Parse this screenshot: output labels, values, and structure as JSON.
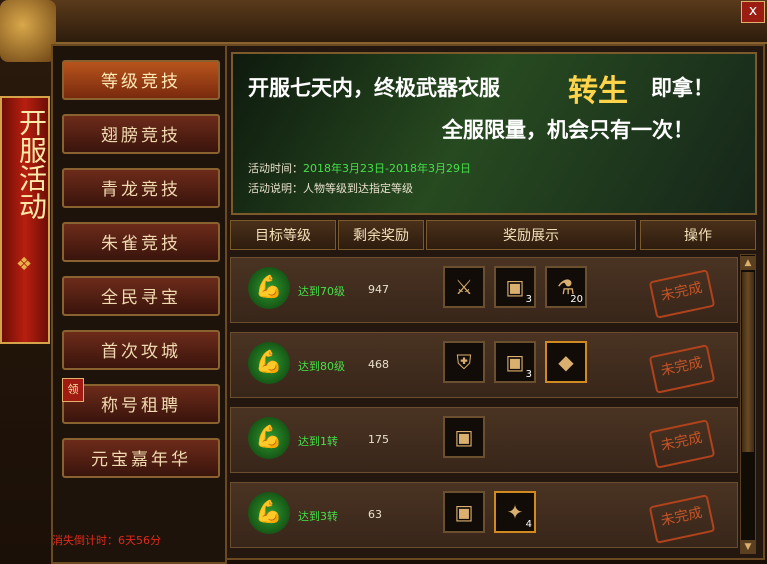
{
  "window": {
    "close_symbol": "x"
  },
  "ribbon": {
    "title": "开服活动"
  },
  "nav": {
    "items": [
      {
        "label": "等级竞技"
      },
      {
        "label": "翅膀竞技"
      },
      {
        "label": "青龙竞技"
      },
      {
        "label": "朱雀竞技"
      },
      {
        "label": "全民寻宝"
      },
      {
        "label": "首次攻城"
      },
      {
        "label": "称号租聘"
      },
      {
        "label": "元宝嘉年华"
      }
    ],
    "badge": "领"
  },
  "countdown": "消失倒计时：6天56分",
  "banner": {
    "line1_a": "开服七天内，终极武器衣服",
    "line1_b": "转生",
    "line1_c": "即拿！",
    "line2": "全服限量，机会只有一次！",
    "time_label": "活动时间：",
    "time_value": "2018年3月23日-2018年3月29日",
    "desc": "活动说明：人物等级到达指定等级"
  },
  "table": {
    "headers": [
      "目标等级",
      "剩余奖励",
      "奖励展示",
      "操作"
    ],
    "rows": [
      {
        "target": "达到70级",
        "remaining": "947",
        "items": [
          {
            "icon": "sword-icon",
            "qty": ""
          },
          {
            "icon": "chest-icon",
            "qty": "3"
          },
          {
            "icon": "potion-icon",
            "qty": "20"
          }
        ],
        "status": "未完成"
      },
      {
        "target": "达到80级",
        "remaining": "468",
        "items": [
          {
            "icon": "armor-icon",
            "qty": ""
          },
          {
            "icon": "chest-icon",
            "qty": "3"
          },
          {
            "icon": "gem-icon",
            "qty": ""
          }
        ],
        "status": "未完成"
      },
      {
        "target": "达到1转",
        "remaining": "175",
        "items": [
          {
            "icon": "chest-icon",
            "qty": ""
          }
        ],
        "status": "未完成"
      },
      {
        "target": "达到3转",
        "remaining": "63",
        "items": [
          {
            "icon": "chest-icon",
            "qty": ""
          },
          {
            "icon": "crystal-icon",
            "qty": "4"
          }
        ],
        "status": "未完成"
      }
    ]
  },
  "colors": {
    "accent_gold": "#ffd34a",
    "level_green": "#46e04a",
    "countdown_red": "#e02a1c"
  }
}
